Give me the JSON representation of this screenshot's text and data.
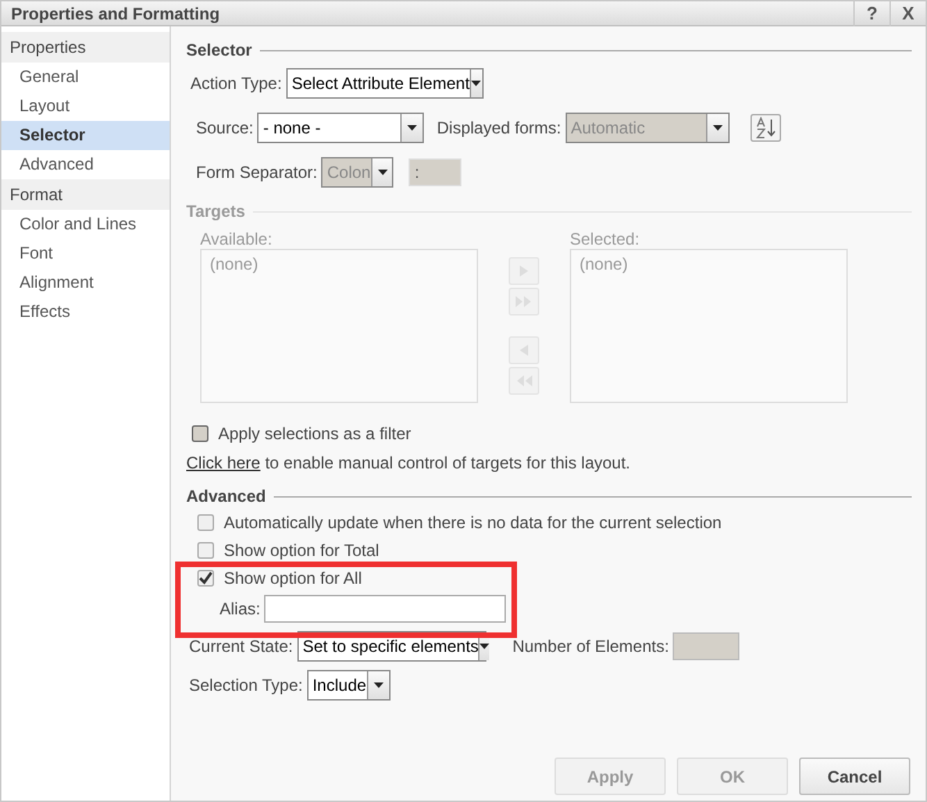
{
  "window": {
    "title": "Properties and Formatting",
    "controls": [
      "?",
      "X"
    ]
  },
  "sidebar": [
    {
      "label": "Properties",
      "items": [
        {
          "label": "General",
          "selected": false
        },
        {
          "label": "Layout",
          "selected": false
        },
        {
          "label": "Selector",
          "selected": true
        },
        {
          "label": "Advanced",
          "selected": false
        }
      ]
    },
    {
      "label": "Format",
      "items": [
        {
          "label": "Color and Lines",
          "selected": false
        },
        {
          "label": "Font",
          "selected": false
        },
        {
          "label": "Alignment",
          "selected": false
        },
        {
          "label": "Effects",
          "selected": false
        }
      ]
    }
  ],
  "selector": {
    "title": "Selector",
    "action_type": {
      "label": "Action Type:",
      "value": "Select Attribute Element",
      "disabled": false
    },
    "source": {
      "label": "Source:",
      "value": "- none -",
      "disabled": false
    },
    "displayed_forms": {
      "label": "Displayed forms:",
      "value": "Automatic",
      "disabled": true
    },
    "form_separator": {
      "label": "Form Separator:",
      "value": "Colon",
      "disabled": true
    },
    "separator_value": {
      "value": ":"
    }
  },
  "targets": {
    "title": "Targets",
    "available": {
      "label": "Available:",
      "items": [
        "(none)"
      ]
    },
    "selected": {
      "label": "Selected:",
      "items": [
        "(none)"
      ]
    },
    "filter": {
      "label": "Apply selections as a filter",
      "checked": false
    },
    "link": "Click here",
    "link_rest": " to enable manual control of targets for this layout."
  },
  "advanced": {
    "title": "Advanced",
    "options": [
      {
        "label": "Automatically update when there is no data for the current selection",
        "checked": false
      },
      {
        "label": "Show option for Total",
        "checked": false
      },
      {
        "label": "Show option for All",
        "checked": true
      }
    ],
    "alias": {
      "label": "Alias:"
    },
    "current_state": {
      "label": "Current State:",
      "value": "Set to specific elements",
      "disabled": false
    },
    "number_of_elements": {
      "label": "Number of Elements:"
    },
    "selection_type": {
      "label": "Selection Type:",
      "value": "Include",
      "disabled": false
    }
  },
  "buttons": [
    {
      "label": "Apply",
      "disabled": true
    },
    {
      "label": "OK",
      "disabled": true
    },
    {
      "label": "Cancel",
      "disabled": false
    }
  ]
}
